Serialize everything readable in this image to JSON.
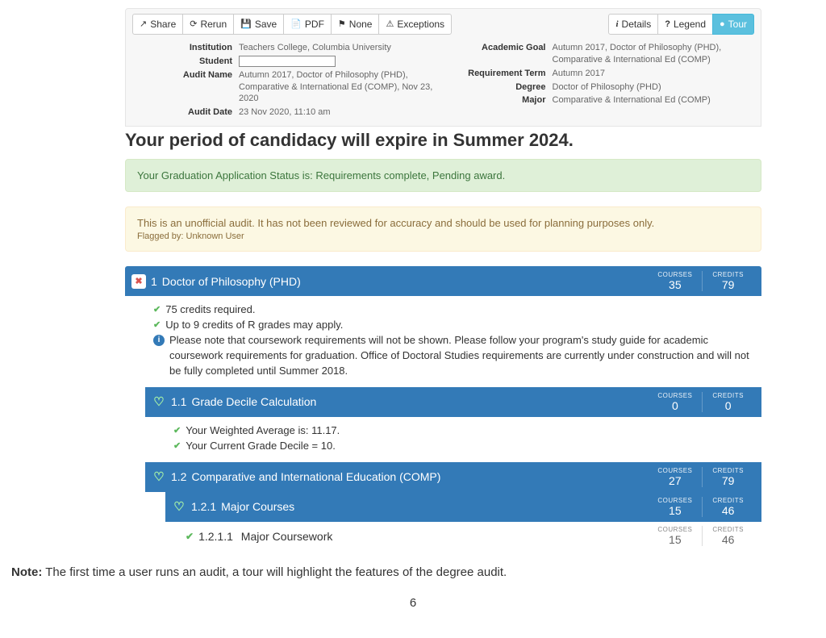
{
  "toolbar": {
    "left": [
      {
        "icon": "↗",
        "label": "Share",
        "name": "share-button"
      },
      {
        "icon": "⟳",
        "label": "Rerun",
        "name": "rerun-button"
      },
      {
        "icon": "💾",
        "label": "Save",
        "name": "save-button"
      },
      {
        "icon": "📄",
        "label": "PDF",
        "name": "pdf-button"
      },
      {
        "icon": "⚑",
        "label": "None",
        "name": "flag-button"
      },
      {
        "icon": "⚠",
        "label": "Exceptions",
        "name": "exceptions-button"
      }
    ],
    "right": [
      {
        "icon": "i",
        "label": "Details",
        "name": "details-button",
        "variant": "default"
      },
      {
        "icon": "?",
        "label": "Legend",
        "name": "legend-button",
        "variant": "default"
      },
      {
        "icon": "●",
        "label": "Tour",
        "name": "tour-button",
        "variant": "info"
      }
    ]
  },
  "info": {
    "left": [
      {
        "label": "Institution",
        "value": "Teachers College, Columbia University"
      },
      {
        "label": "Student",
        "value": ""
      },
      {
        "label": "Audit Name",
        "value": "Autumn 2017, Doctor of Philosophy (PHD), Comparative & International Ed (COMP), Nov 23, 2020"
      },
      {
        "label": "Audit Date",
        "value": "23 Nov 2020, 11:10 am"
      }
    ],
    "right": [
      {
        "label": "Academic Goal",
        "value": "Autumn 2017, Doctor of Philosophy (PHD), Comparative & International Ed (COMP)"
      },
      {
        "label": "Requirement Term",
        "value": "Autumn 2017"
      },
      {
        "label": "Degree",
        "value": "Doctor of Philosophy (PHD)"
      },
      {
        "label": "Major",
        "value": "Comparative & International Ed (COMP)"
      }
    ]
  },
  "headline": "Your period of candidacy will expire in Summer 2024.",
  "alerts": {
    "success": "Your Graduation Application Status is: Requirements complete, Pending award.",
    "warning_main": "This is an unofficial audit. It has not been reviewed for accuracy and should be used for planning purposes only.",
    "warning_sub": "Flagged by: Unknown User"
  },
  "req1": {
    "num": "1",
    "title": "Doctor of Philosophy (PHD)",
    "courses": "35",
    "credits": "79",
    "rules": [
      {
        "type": "check",
        "text": "75 credits required."
      },
      {
        "type": "check",
        "text": "Up to 9 credits of R grades may apply."
      },
      {
        "type": "info",
        "text": "Please note that coursework requirements will not be shown. Please follow your program's study guide for academic coursework requirements for graduation. Office of Doctoral Studies requirements are currently under construction and will not be fully completed until Summer 2018."
      }
    ]
  },
  "req11": {
    "num": "1.1",
    "title": "Grade Decile Calculation",
    "courses": "0",
    "credits": "0",
    "rules": [
      {
        "type": "check",
        "text": "Your Weighted Average is: 11.17."
      },
      {
        "type": "check",
        "text": "Your Current Grade Decile = 10."
      }
    ]
  },
  "req12": {
    "num": "1.2",
    "title": "Comparative and International Education (COMP)",
    "courses": "27",
    "credits": "79"
  },
  "req121": {
    "num": "1.2.1",
    "title": "Major Courses",
    "courses": "15",
    "credits": "46"
  },
  "req1211": {
    "num": "1.2.1.1",
    "title": "Major Coursework",
    "courses": "15",
    "credits": "46"
  },
  "counter_labels": {
    "courses": "COURSES",
    "credits": "CREDITS"
  },
  "footnote": {
    "bold": "Note:",
    "text": " The first time a user runs an audit, a tour will highlight the features of the degree audit."
  },
  "page_number": "6"
}
